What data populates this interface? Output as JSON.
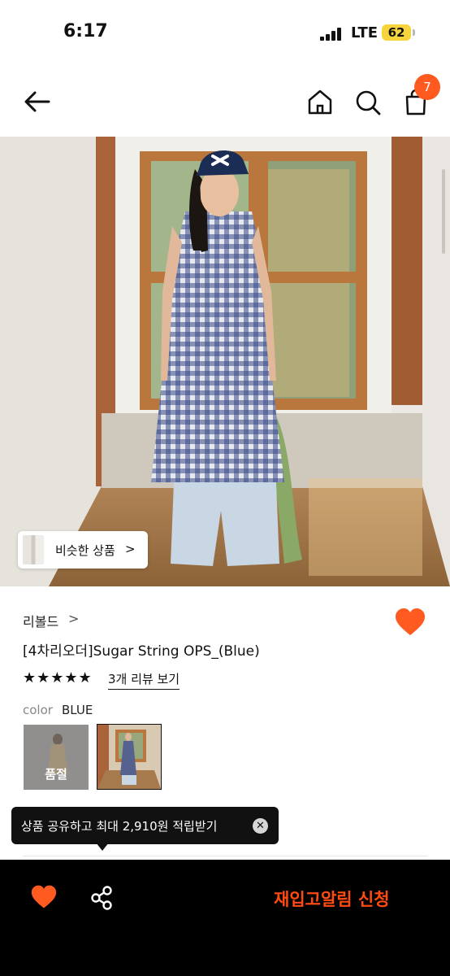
{
  "status_bar": {
    "time": "6:17",
    "network": "LTE",
    "battery": "62"
  },
  "nav": {
    "cart_count": "7"
  },
  "hero": {
    "similar_label": "비슷한 상품",
    "similar_chevron": ">"
  },
  "product": {
    "brand": "리볼드",
    "brand_chevron": ">",
    "title": "[4차리오더]Sugar String OPS_(Blue)",
    "rating_stars": "★★★★★",
    "rating_value": 5,
    "review_link": "3개 리뷰 보기",
    "color_label": "color",
    "color_value": "BLUE",
    "swatch_soldout": "품절"
  },
  "toast": {
    "text": "상품 공유하고 최대 2,910원 적립받기",
    "close_icon": "close-icon"
  },
  "bottom_bar": {
    "cta": "재입고알림 신청"
  },
  "colors": {
    "accent": "#ff5a1f",
    "cta": "#ff4b12",
    "battery": "#f7d43b",
    "bar": "#000000"
  }
}
